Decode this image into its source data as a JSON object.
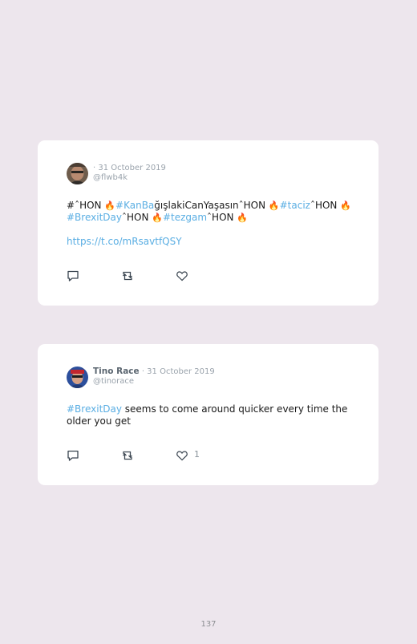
{
  "tweets": [
    {
      "author": "",
      "date": "· 31 October 2019",
      "handle": "@flwb4k",
      "line1": [
        {
          "t": "#",
          "k": "text"
        },
        {
          "t": "ˆ",
          "k": "text"
        },
        {
          "t": "HON ",
          "k": "text"
        },
        {
          "t": "🔥",
          "k": "flame"
        },
        {
          "t": "#KanBa",
          "k": "tag"
        },
        {
          "t": "ğışlakiCanYaşasın",
          "k": "text"
        },
        {
          "t": "ˆ",
          "k": "text"
        },
        {
          "t": "HON ",
          "k": "text"
        },
        {
          "t": "🔥",
          "k": "flame"
        },
        {
          "t": "#taciz",
          "k": "tag"
        },
        {
          "t": "ˆ",
          "k": "text"
        },
        {
          "t": "HON ",
          "k": "text"
        },
        {
          "t": "🔥",
          "k": "flame"
        }
      ],
      "line2": [
        {
          "t": "#BrexitDay",
          "k": "tag"
        },
        {
          "t": "ˆ",
          "k": "text"
        },
        {
          "t": "HON ",
          "k": "text"
        },
        {
          "t": "🔥",
          "k": "flame"
        },
        {
          "t": "#tezgam",
          "k": "tag"
        },
        {
          "t": "ˆ",
          "k": "text"
        },
        {
          "t": "HON ",
          "k": "text"
        },
        {
          "t": "🔥",
          "k": "flame"
        }
      ],
      "link": "https://t.co/mRsavtfQSY",
      "likes": ""
    },
    {
      "author": "Tino Race",
      "date": "· 31 October 2019",
      "handle": "@tinorace",
      "line1": [
        {
          "t": "#BrexitDay",
          "k": "tag"
        },
        {
          "t": " seems to come around quicker every time the",
          "k": "text"
        }
      ],
      "line2": [
        {
          "t": "older you get",
          "k": "text"
        }
      ],
      "link": "",
      "likes": "1"
    }
  ],
  "icons": [
    "reply-icon",
    "retweet-icon",
    "like-icon"
  ],
  "colors": {
    "background": "#ede6ed",
    "card": "#ffffff",
    "hashtag": "#5aaee3",
    "meta": "#9aa3ac"
  },
  "page_number": "137"
}
